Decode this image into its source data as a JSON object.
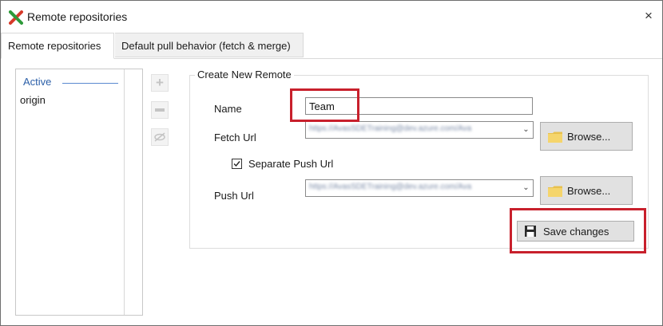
{
  "window": {
    "title": "Remote repositories",
    "close_glyph": "×"
  },
  "tabs": [
    {
      "label": "Remote repositories",
      "active": true
    },
    {
      "label": "Default pull behavior (fetch & merge)",
      "active": false
    }
  ],
  "remote_list": {
    "header": "Active",
    "items": [
      "origin"
    ]
  },
  "side_buttons": [
    {
      "icon": "plus-icon",
      "glyph": "+"
    },
    {
      "icon": "minus-icon",
      "glyph": ""
    },
    {
      "icon": "eye-icon",
      "glyph": ""
    }
  ],
  "form": {
    "group_title": "Create New Remote",
    "name_label": "Name",
    "name_value": "Team",
    "fetch_label": "Fetch Url",
    "fetch_value": "https://AvasSDETraining@dev.azure.com/Ava",
    "separate_push_label": "Separate Push Url",
    "separate_push_checked": true,
    "push_label": "Push Url",
    "push_value": "https://AvasSDETraining@dev.azure.com/Ava",
    "browse_label": "Browse...",
    "save_label": "Save changes"
  },
  "colors": {
    "highlight": "#c8202c",
    "accent": "#2b5fa8"
  }
}
